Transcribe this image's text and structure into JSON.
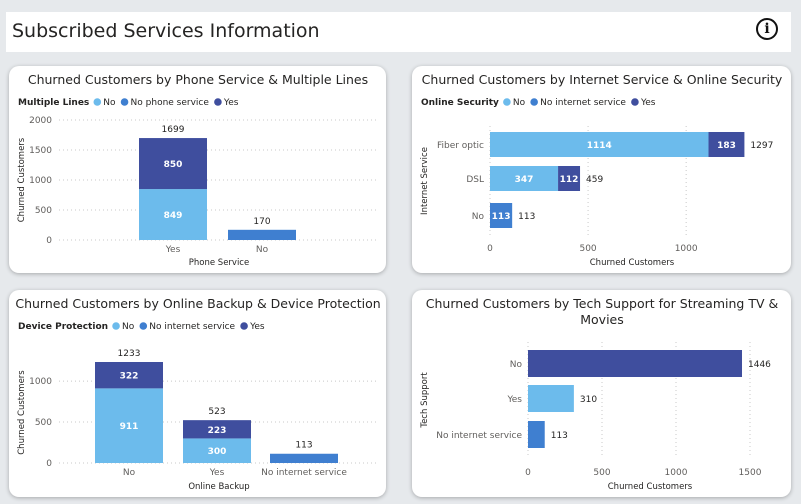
{
  "header": {
    "title": "Subscribed Services Information",
    "info_icon": "info-icon"
  },
  "colors": {
    "No": "#6cbbec",
    "No phone service": "#3f7fd0",
    "No internet service": "#3f7fd0",
    "Yes": "#3f4e9e"
  },
  "chart_data": [
    {
      "type": "bar",
      "orientation": "vertical",
      "stacked": true,
      "title": "Churned Customers by Phone Service & Multiple Lines",
      "legend_title": "Multiple Lines",
      "legend": [
        "No",
        "No phone service",
        "Yes"
      ],
      "xlabel": "Phone Service",
      "ylabel": "Churned Customers",
      "categories": [
        "Yes",
        "No"
      ],
      "series": [
        {
          "name": "No",
          "values": [
            849,
            0
          ]
        },
        {
          "name": "No phone service",
          "values": [
            0,
            170
          ]
        },
        {
          "name": "Yes",
          "values": [
            850,
            0
          ]
        }
      ],
      "totals": [
        1699,
        170
      ],
      "yticks": [
        0,
        500,
        1000,
        1500,
        2000
      ],
      "ylim": [
        0,
        2000
      ],
      "grid": true
    },
    {
      "type": "bar",
      "orientation": "horizontal",
      "stacked": true,
      "title": "Churned Customers by Internet Service & Online Security",
      "legend_title": "Online Security",
      "legend": [
        "No",
        "No internet service",
        "Yes"
      ],
      "xlabel": "Churned Customers",
      "ylabel": "Internet Service",
      "categories": [
        "Fiber optic",
        "DSL",
        "No"
      ],
      "series": [
        {
          "name": "No",
          "values": [
            1114,
            347,
            0
          ]
        },
        {
          "name": "No internet service",
          "values": [
            0,
            0,
            113
          ]
        },
        {
          "name": "Yes",
          "values": [
            183,
            112,
            0
          ]
        }
      ],
      "totals": [
        1297,
        459,
        113
      ],
      "xticks": [
        0,
        500,
        1000
      ],
      "xlim": [
        0,
        1300
      ],
      "grid": true
    },
    {
      "type": "bar",
      "orientation": "vertical",
      "stacked": true,
      "title": "Churned Customers by Online Backup & Device Protection",
      "legend_title": "Device Protection",
      "legend": [
        "No",
        "No internet service",
        "Yes"
      ],
      "xlabel": "Online Backup",
      "ylabel": "Churned Customers",
      "categories": [
        "No",
        "Yes",
        "No internet service"
      ],
      "series": [
        {
          "name": "No",
          "values": [
            911,
            300,
            0
          ]
        },
        {
          "name": "No internet service",
          "values": [
            0,
            0,
            113
          ]
        },
        {
          "name": "Yes",
          "values": [
            322,
            223,
            0
          ]
        }
      ],
      "totals": [
        1233,
        523,
        113
      ],
      "yticks": [
        0,
        500,
        1000
      ],
      "ylim": [
        0,
        1233
      ],
      "grid": true
    },
    {
      "type": "bar",
      "orientation": "horizontal",
      "stacked": false,
      "title_lines": [
        "Churned Customers by Tech Support for Streaming TV &",
        "Movies"
      ],
      "xlabel": "Churned Customers",
      "ylabel": "Tech Support",
      "categories": [
        "No",
        "Yes",
        "No internet service"
      ],
      "values": [
        1446,
        310,
        113
      ],
      "bar_colors": [
        "#3f4e9e",
        "#6cbbec",
        "#3f7fd0"
      ],
      "xticks": [
        0,
        500,
        1000,
        1500
      ],
      "xlim": [
        0,
        1500
      ],
      "grid": true
    }
  ]
}
